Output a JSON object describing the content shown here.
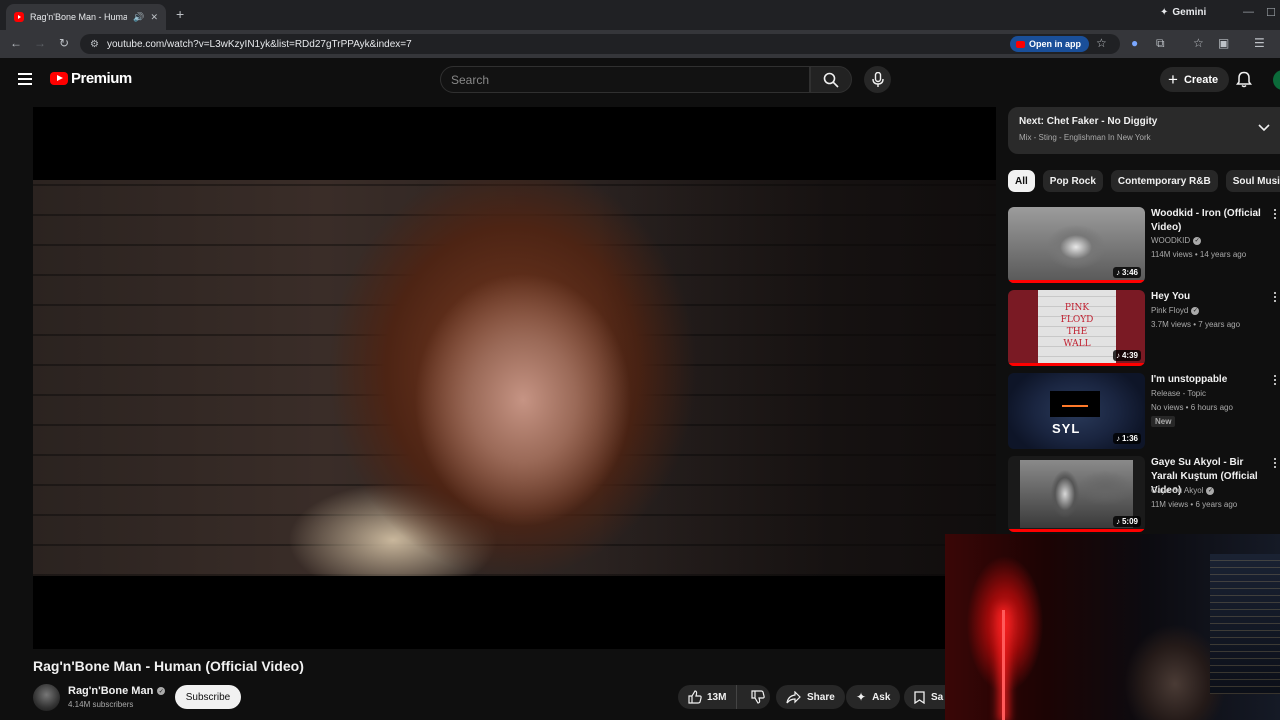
{
  "browser": {
    "tab_title": "Rag'n'Bone Man - Human (",
    "url": "youtube.com/watch?v=L3wKzyIN1yk&list=RDd27gTrPPAyk&index=7",
    "open_in_app": "Open in app",
    "gemini": "Gemini"
  },
  "header": {
    "logo_text": "Premium",
    "search_placeholder": "Search",
    "create_label": "Create"
  },
  "video": {
    "title": "Rag'n'Bone Man - Human (Official Video)",
    "channel": "Rag'n'Bone Man",
    "subscribers": "4.14M subscribers",
    "subscribe_label": "Subscribe",
    "likes": "13M",
    "share_label": "Share",
    "ask_label": "Ask",
    "save_label": "Sa"
  },
  "playlist": {
    "next_prefix": "Next:",
    "next_title": "Chet Faker - No Diggity",
    "mix_line": "Mix - Sting - Englishman In New York"
  },
  "chips": [
    "All",
    "Pop Rock",
    "Contemporary R&B",
    "Soul Music"
  ],
  "recommendations": [
    {
      "title": "Woodkid - Iron (Official Video)",
      "channel": "WOODKID",
      "views": "114M views",
      "age": "14 years ago",
      "duration": "3:46",
      "verified": true
    },
    {
      "title": "Hey You",
      "channel": "Pink Floyd",
      "views": "3.7M views",
      "age": "7 years ago",
      "duration": "4:39",
      "verified": true,
      "thumb_text_1": "PINK",
      "thumb_text_2": "FLOYD",
      "thumb_text_3": "THE",
      "thumb_text_4": "WALL"
    },
    {
      "title": "I'm unstoppable",
      "channel": "Release - Topic",
      "views": "No views",
      "age": "6 hours ago",
      "duration": "1:36",
      "verified": false,
      "badge": "New",
      "thumb_text": "SYL"
    },
    {
      "title": "Gaye Su Akyol - Bir Yaralı Kuştum (Official Video)",
      "channel": "Gaye Su Akyol",
      "views": "11M views",
      "age": "6 years ago",
      "duration": "5:09",
      "verified": true
    }
  ],
  "colors": {
    "accent": "#ff0000",
    "background": "#0f0f0f",
    "chip_bg": "#272727"
  }
}
